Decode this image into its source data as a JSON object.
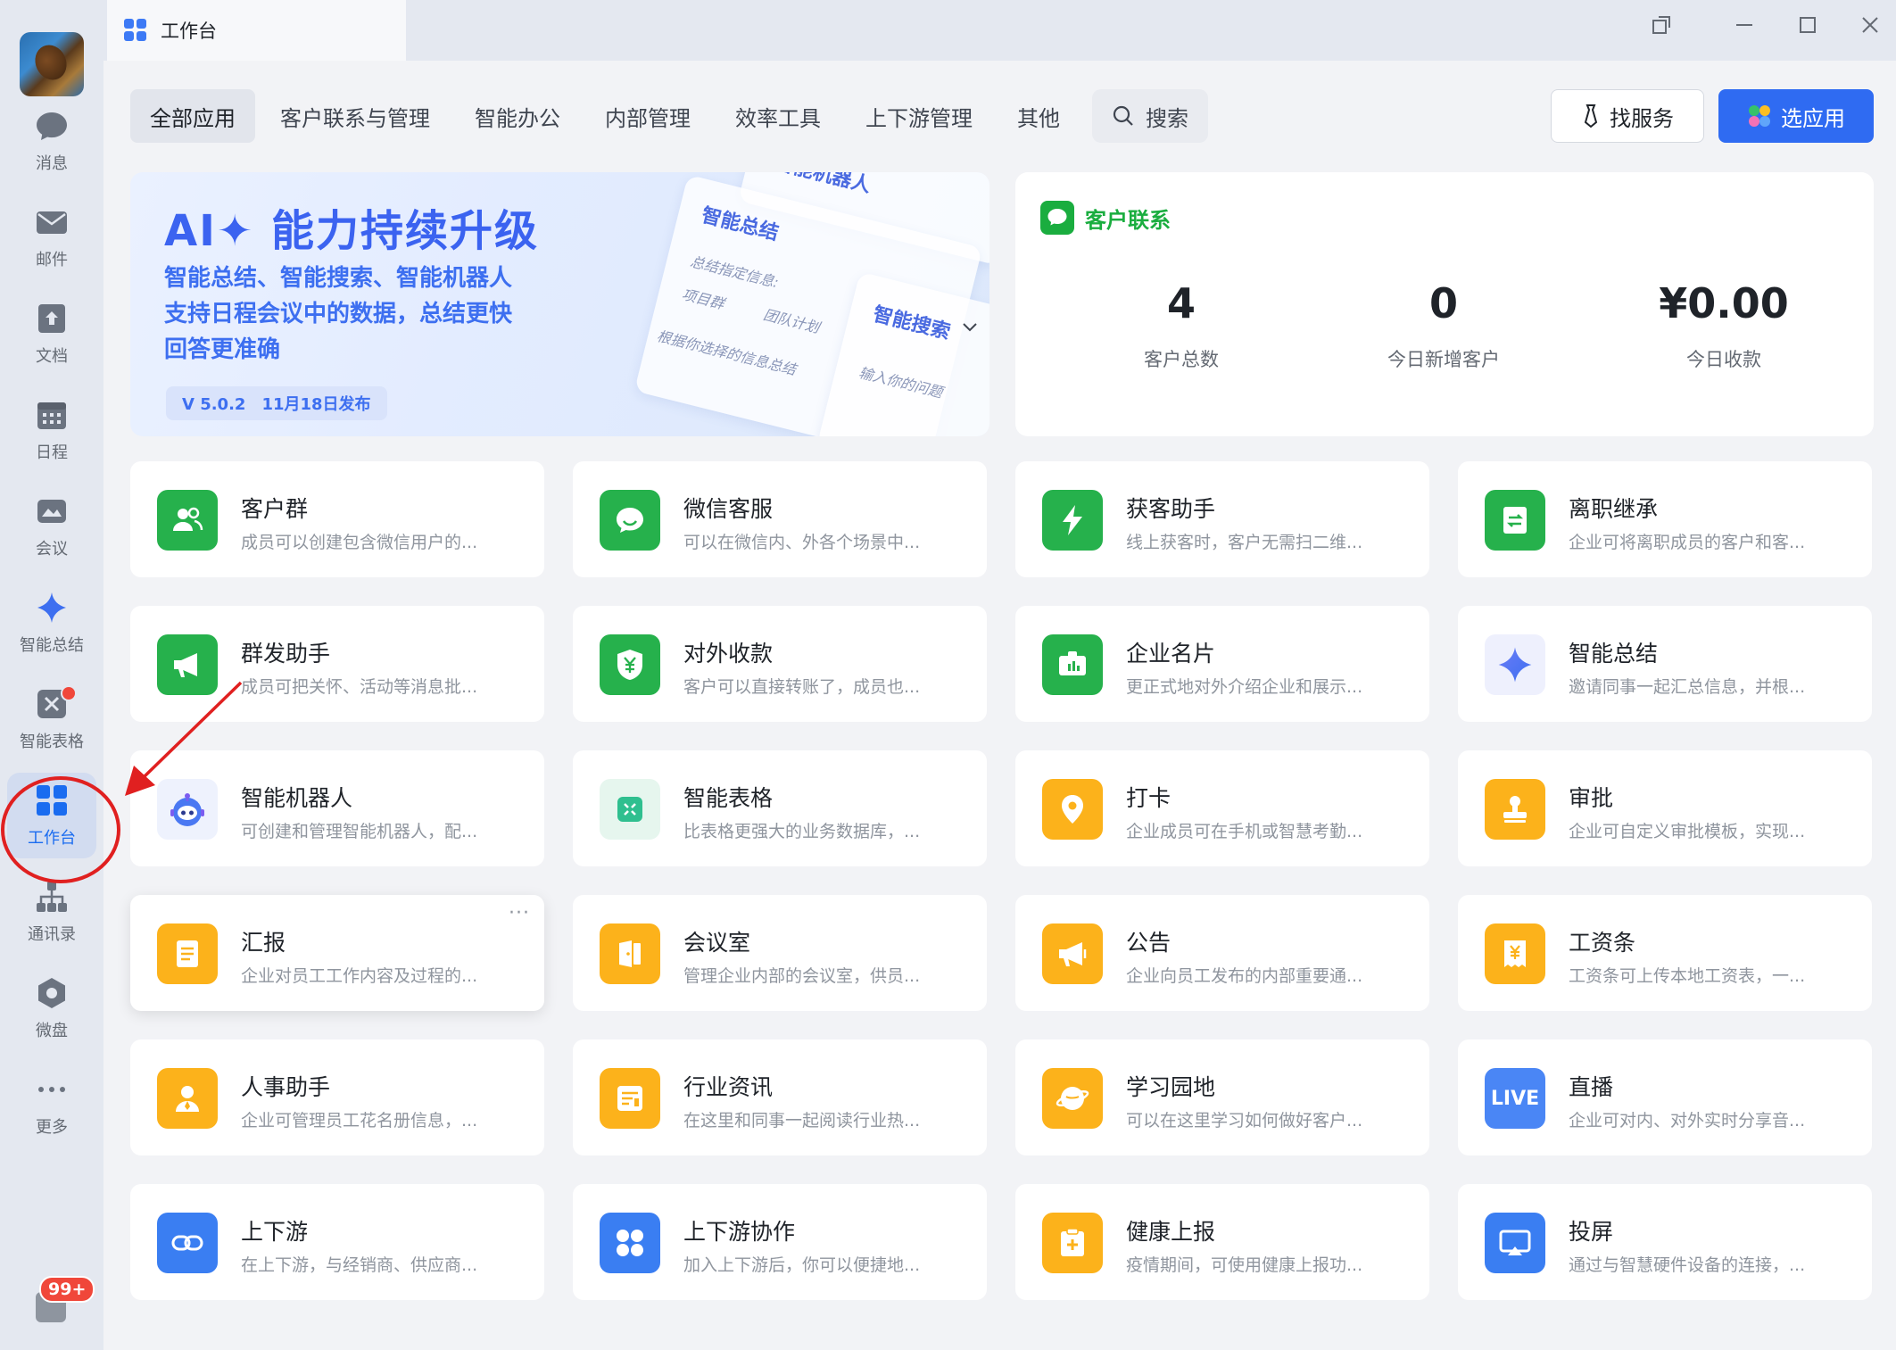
{
  "window": {
    "tab_title": "工作台"
  },
  "sidebar": {
    "items": [
      {
        "label": "消息",
        "icon": "chat-bubble-icon"
      },
      {
        "label": "邮件",
        "icon": "mail-icon"
      },
      {
        "label": "文档",
        "icon": "document-icon"
      },
      {
        "label": "日程",
        "icon": "calendar-icon"
      },
      {
        "label": "会议",
        "icon": "meeting-icon"
      },
      {
        "label": "智能总结",
        "icon": "sparkle-icon"
      },
      {
        "label": "智能表格",
        "icon": "smart-sheet-icon"
      },
      {
        "label": "工作台",
        "icon": "workbench-grid-icon",
        "active": true
      },
      {
        "label": "通讯录",
        "icon": "org-chart-icon"
      },
      {
        "label": "微盘",
        "icon": "drive-icon"
      },
      {
        "label": "更多",
        "icon": "more-dots-icon"
      }
    ],
    "badge": "99+"
  },
  "categories": [
    "全部应用",
    "客户联系与管理",
    "智能办公",
    "内部管理",
    "效率工具",
    "上下游管理",
    "其他"
  ],
  "search": {
    "label": "搜索"
  },
  "actions": {
    "service": "找服务",
    "choose_app": "选应用"
  },
  "banner": {
    "title": "AI✦ 能力持续升级",
    "line1": "智能总结、智能搜索、智能机器人",
    "line2": "支持日程会议中的数据，总结更快",
    "line3": "回答更准确",
    "version": "V 5.0.2",
    "date": "11月18日发布",
    "mock_robot": "智能机器人",
    "mock_summary": "智能总结",
    "mock_summary_hint": "总结指定信息:",
    "mock_project": "项目群",
    "mock_team": "团队计划",
    "mock_hint2": "根据你选择的信息总结",
    "mock_search": "智能搜索",
    "mock_input": "输入你的问题"
  },
  "customer_contact": {
    "title": "客户联系",
    "stats": [
      {
        "value": "4",
        "label": "客户总数"
      },
      {
        "value": "0",
        "label": "今日新增客户"
      },
      {
        "value": "¥0.00",
        "label": "今日收款"
      }
    ]
  },
  "apps": [
    {
      "name": "客户群",
      "desc": "成员可以创建包含微信用户的...",
      "icon": "customer-group-icon"
    },
    {
      "name": "微信客服",
      "desc": "可以在微信内、外各个场景中...",
      "icon": "wechat-service-icon"
    },
    {
      "name": "获客助手",
      "desc": "线上获客时，客户无需扫二维...",
      "icon": "lightning-icon"
    },
    {
      "name": "离职继承",
      "desc": "企业可将离职成员的客户和客...",
      "icon": "transfer-icon"
    },
    {
      "name": "群发助手",
      "desc": "成员可把关怀、活动等消息批...",
      "icon": "megaphone-icon"
    },
    {
      "name": "对外收款",
      "desc": "客户可以直接转账了，成员也...",
      "icon": "yuan-shield-icon"
    },
    {
      "name": "企业名片",
      "desc": "更正式地对外介绍企业和展示...",
      "icon": "business-card-icon"
    },
    {
      "name": "智能总结",
      "desc": "邀请同事一起汇总信息，并根...",
      "icon": "sparkle-icon"
    },
    {
      "name": "智能机器人",
      "desc": "可创建和管理智能机器人，配...",
      "icon": "robot-icon"
    },
    {
      "name": "智能表格",
      "desc": "比表格更强大的业务数据库，...",
      "icon": "smart-sheet-icon"
    },
    {
      "name": "打卡",
      "desc": "企业成员可在手机或智慧考勤...",
      "icon": "location-pin-icon"
    },
    {
      "name": "审批",
      "desc": "企业可自定义审批模板，实现...",
      "icon": "stamp-icon"
    },
    {
      "name": "汇报",
      "desc": "企业对员工工作内容及过程的...",
      "icon": "report-icon",
      "more": "···"
    },
    {
      "name": "会议室",
      "desc": "管理企业内部的会议室，供员...",
      "icon": "door-icon"
    },
    {
      "name": "公告",
      "desc": "企业向员工发布的内部重要通...",
      "icon": "announce-icon"
    },
    {
      "name": "工资条",
      "desc": "工资条可上传本地工资表，一...",
      "icon": "payslip-icon"
    },
    {
      "name": "人事助手",
      "desc": "企业可管理员工花名册信息，...",
      "icon": "person-icon"
    },
    {
      "name": "行业资讯",
      "desc": "在这里和同事一起阅读行业热...",
      "icon": "news-icon"
    },
    {
      "name": "学习园地",
      "desc": "可以在这里学习如何做好客户...",
      "icon": "learning-icon"
    },
    {
      "name": "直播",
      "desc": "企业可对内、对外实时分享音...",
      "icon": "live-icon",
      "icon_text": "LIVE"
    },
    {
      "name": "上下游",
      "desc": "在上下游，与经销商、供应商...",
      "icon": "link-icon"
    },
    {
      "name": "上下游协作",
      "desc": "加入上下游后，你可以便捷地...",
      "icon": "grid-apps-icon"
    },
    {
      "name": "健康上报",
      "desc": "疫情期间，可使用健康上报功...",
      "icon": "health-icon"
    },
    {
      "name": "投屏",
      "desc": "通过与智慧硬件设备的连接，...",
      "icon": "screen-cast-icon"
    }
  ],
  "colors": {
    "accent_blue": "#2f6bf2",
    "green": "#26b14c",
    "orange": "#fcb21b",
    "annotation_red": "#e02020"
  }
}
